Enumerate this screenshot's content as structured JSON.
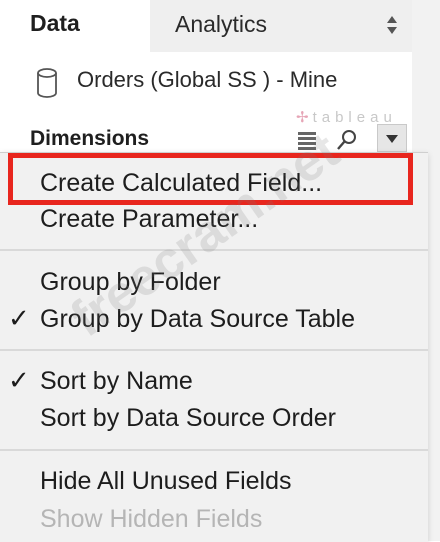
{
  "tabs": {
    "data_label": "Data",
    "analytics_label": "Analytics"
  },
  "datasource": {
    "label": "Orders (Global SS ) - Mine"
  },
  "dimensions": {
    "title": "Dimensions"
  },
  "brand": {
    "logo_text": "tableau"
  },
  "menu": {
    "items": [
      {
        "label": "Create Calculated Field...",
        "checked": false,
        "enabled": true
      },
      {
        "label": "Create Parameter...",
        "checked": false,
        "enabled": true
      },
      {
        "label": "Group by Folder",
        "checked": false,
        "enabled": true
      },
      {
        "label": "Group by Data Source Table",
        "checked": true,
        "enabled": true
      },
      {
        "label": "Sort by Name",
        "checked": true,
        "enabled": true
      },
      {
        "label": "Sort by Data Source Order",
        "checked": false,
        "enabled": true
      },
      {
        "label": "Hide All Unused Fields",
        "checked": false,
        "enabled": true
      },
      {
        "label": "Show Hidden Fields",
        "checked": false,
        "enabled": false
      }
    ],
    "check_glyph": "✓"
  },
  "watermark": {
    "text": "freecram.net"
  },
  "colors": {
    "highlight": "#e8261e",
    "menu_bg": "#f1f1f1",
    "disabled_text": "#b5b5b5"
  },
  "icons": {
    "datasource": "database-icon",
    "sort": "sort-arrows-icon",
    "grid": "grid-icon",
    "search": "search-icon",
    "dropdown": "chevron-down-icon"
  }
}
